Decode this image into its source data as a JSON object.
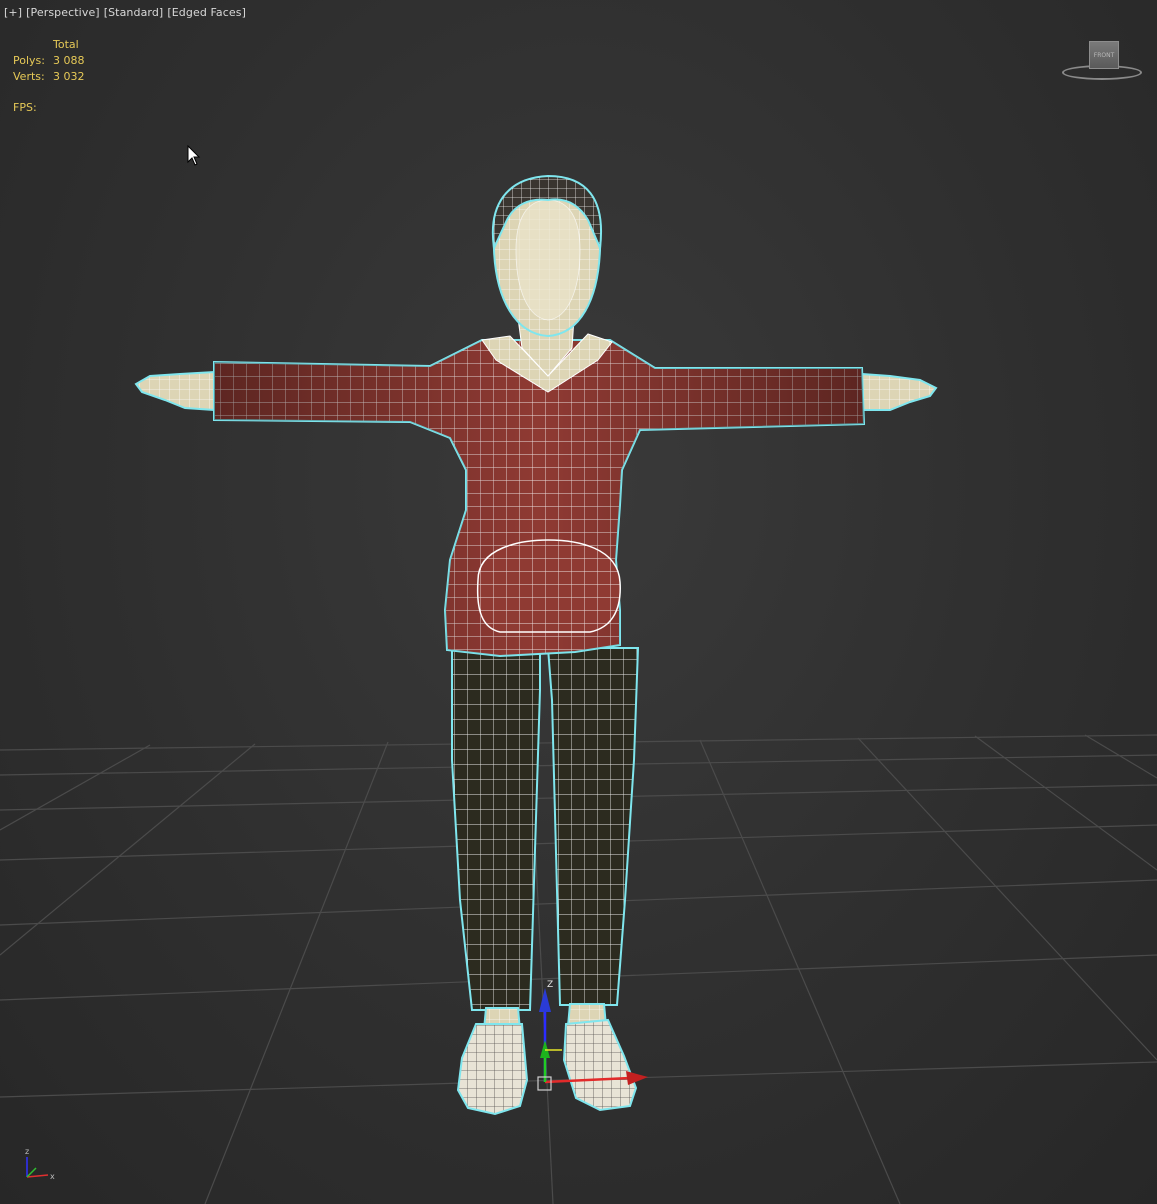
{
  "viewport": {
    "labels": [
      "[+]",
      "[Perspective]",
      "[Standard]",
      "[Edged Faces]"
    ]
  },
  "stats": {
    "header": "Total",
    "polys_label": "Polys:",
    "polys_value": "3 088",
    "verts_label": "Verts:",
    "verts_value": "3 032",
    "fps_label": "FPS:"
  },
  "viewcube": {
    "face_label": "FRONT"
  },
  "gizmo": {
    "z": "Z"
  },
  "axis_tripod": {
    "z": "z",
    "x": "x"
  },
  "colors": {
    "hoodie": "#8f3a33",
    "pants": "#2c2b1f",
    "skin": "#ddd5b5",
    "wire": "#ffffff",
    "selection": "#7fe6ee",
    "grid": "#4b4b4b",
    "stats_text": "#e6c957"
  }
}
